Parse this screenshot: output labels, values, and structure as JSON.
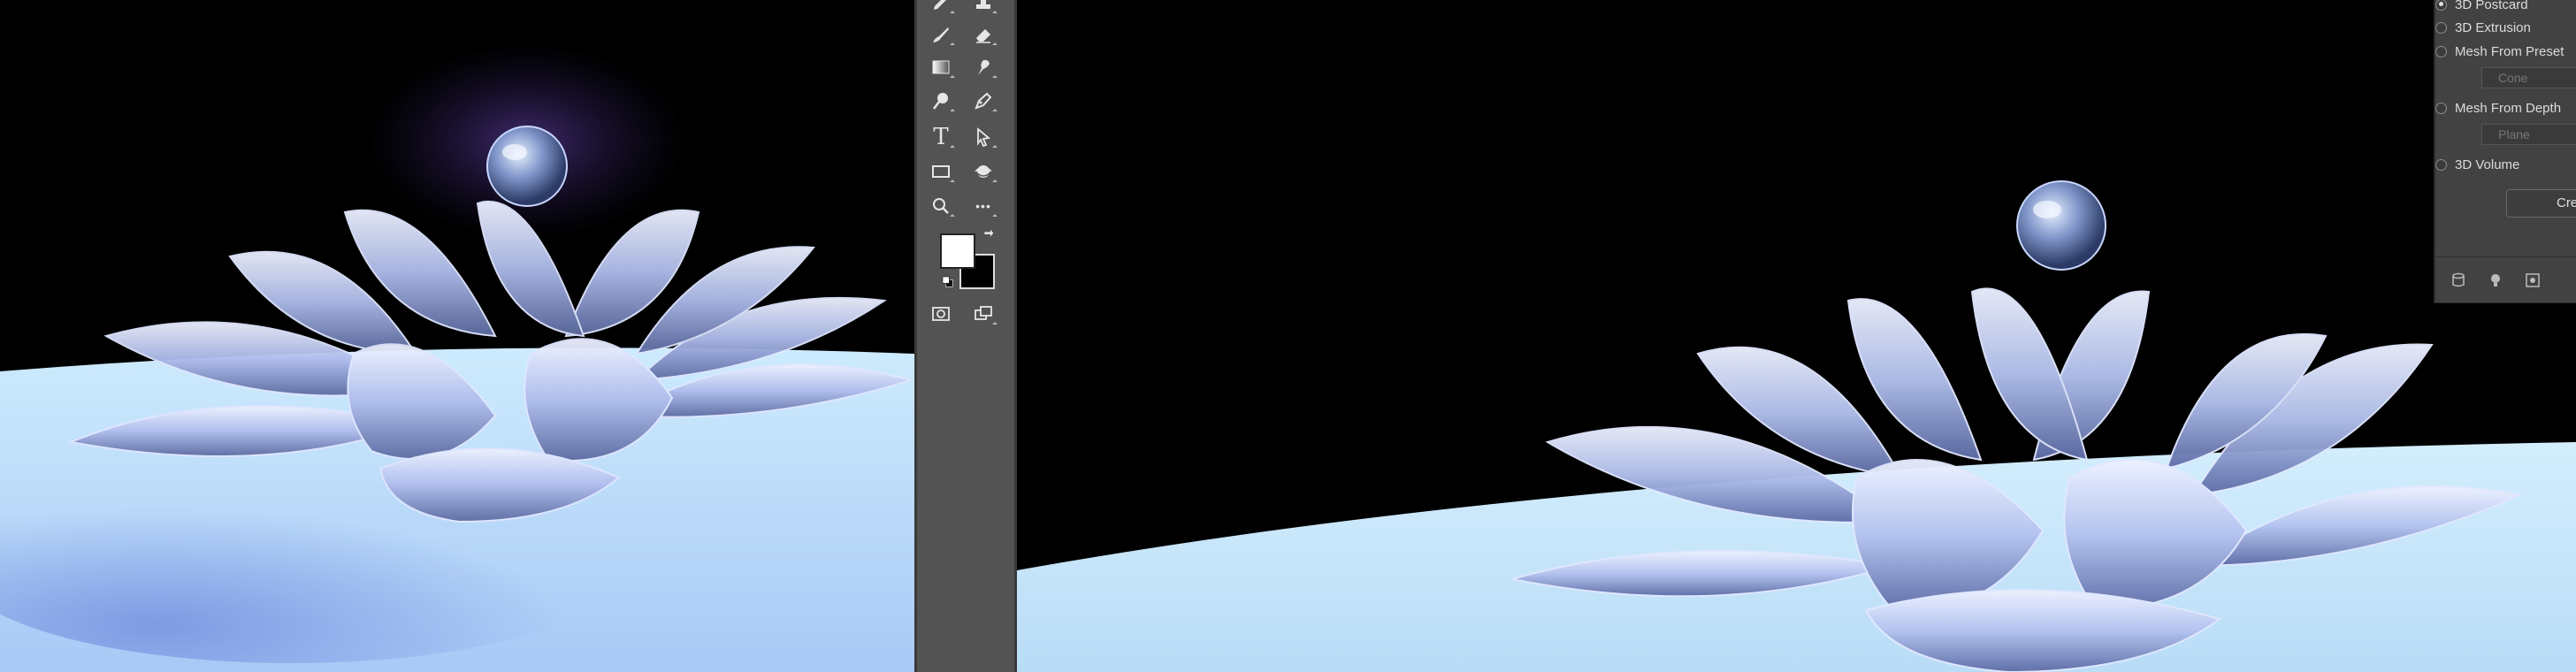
{
  "toolbar": {
    "tools": [
      "pencil-tool",
      "healing-brush-tool",
      "eraser-tool",
      "gradient-tool",
      "smudge-tool",
      "dodge-tool",
      "pen-tool",
      "type-tool",
      "path-selection-tool",
      "rectangle-tool",
      "3d-tool",
      "zoom-tool",
      "more-tools"
    ],
    "type_tool_glyph": "T",
    "more_glyph": "•••"
  },
  "panel3d": {
    "options": [
      {
        "label": "3D Postcard",
        "selected": true
      },
      {
        "label": "3D Extrusion",
        "selected": false
      },
      {
        "label": "Mesh From Preset",
        "selected": false
      },
      {
        "label": "Mesh From Depth",
        "selected": false
      },
      {
        "label": "3D Volume",
        "selected": false
      }
    ],
    "preset_value": "Cone",
    "depth_value": "Plane",
    "create_label": "Crea"
  },
  "colors": {
    "foreground": "#ffffff",
    "background": "#000000",
    "panel_bg": "#424242",
    "toolbar_bg": "#535353",
    "floor": "#c7e6fb",
    "petal": "#b9c6ee"
  }
}
